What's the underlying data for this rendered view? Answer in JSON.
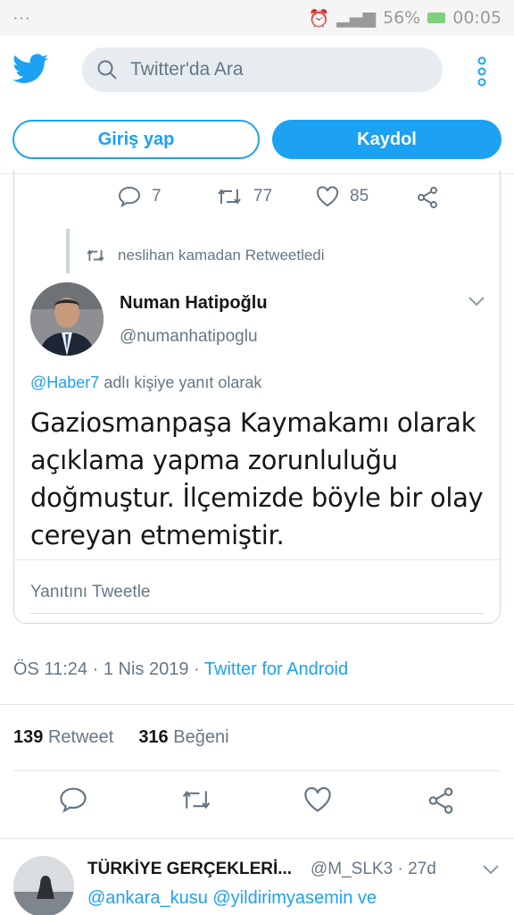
{
  "status_bar": {
    "left": "···",
    "battery": "56%",
    "time": "00:05"
  },
  "header": {
    "logo_icon": "twitter-bird-icon",
    "search_placeholder": "Twitter'da Ara",
    "menu_icon": "more-vertical-icon",
    "login_label": "Giriş yap",
    "signup_label": "Kaydol",
    "brand_color": "#1da1f2"
  },
  "quoted": {
    "actions": {
      "replies": "7",
      "retweets": "77",
      "likes": "85"
    },
    "retweet_context": "neslihan kamadan Retweetledi",
    "author_name": "Numan Hatipoğlu",
    "author_handle": "@numanhatipoglu",
    "reply_to_handle": "@Haber7",
    "reply_to_suffix": "adlı kişiye yanıt olarak",
    "text": "Gaziosmanpaşa Kaymakamı olarak açıklama yapma zorunluluğu doğmuştur. İlçemizde böyle bir olay cereyan etmemiştir.",
    "reply_placeholder": "Yanıtını Tweetle"
  },
  "meta": {
    "time": "ÖS 11:24",
    "date": "1 Nis 2019",
    "separator": "·",
    "source": "Twitter for Android"
  },
  "stats": {
    "retweet_count": "139",
    "retweet_label": "Retweet",
    "like_count": "316",
    "like_label": "Beğeni"
  },
  "next_tweet": {
    "name": "TÜRKİYE GERÇEKLERİ...",
    "handle": "@M_SLK3",
    "separator": "·",
    "age": "27d",
    "mentions": "@ankara_kusu @yildirimyasemin ve"
  }
}
